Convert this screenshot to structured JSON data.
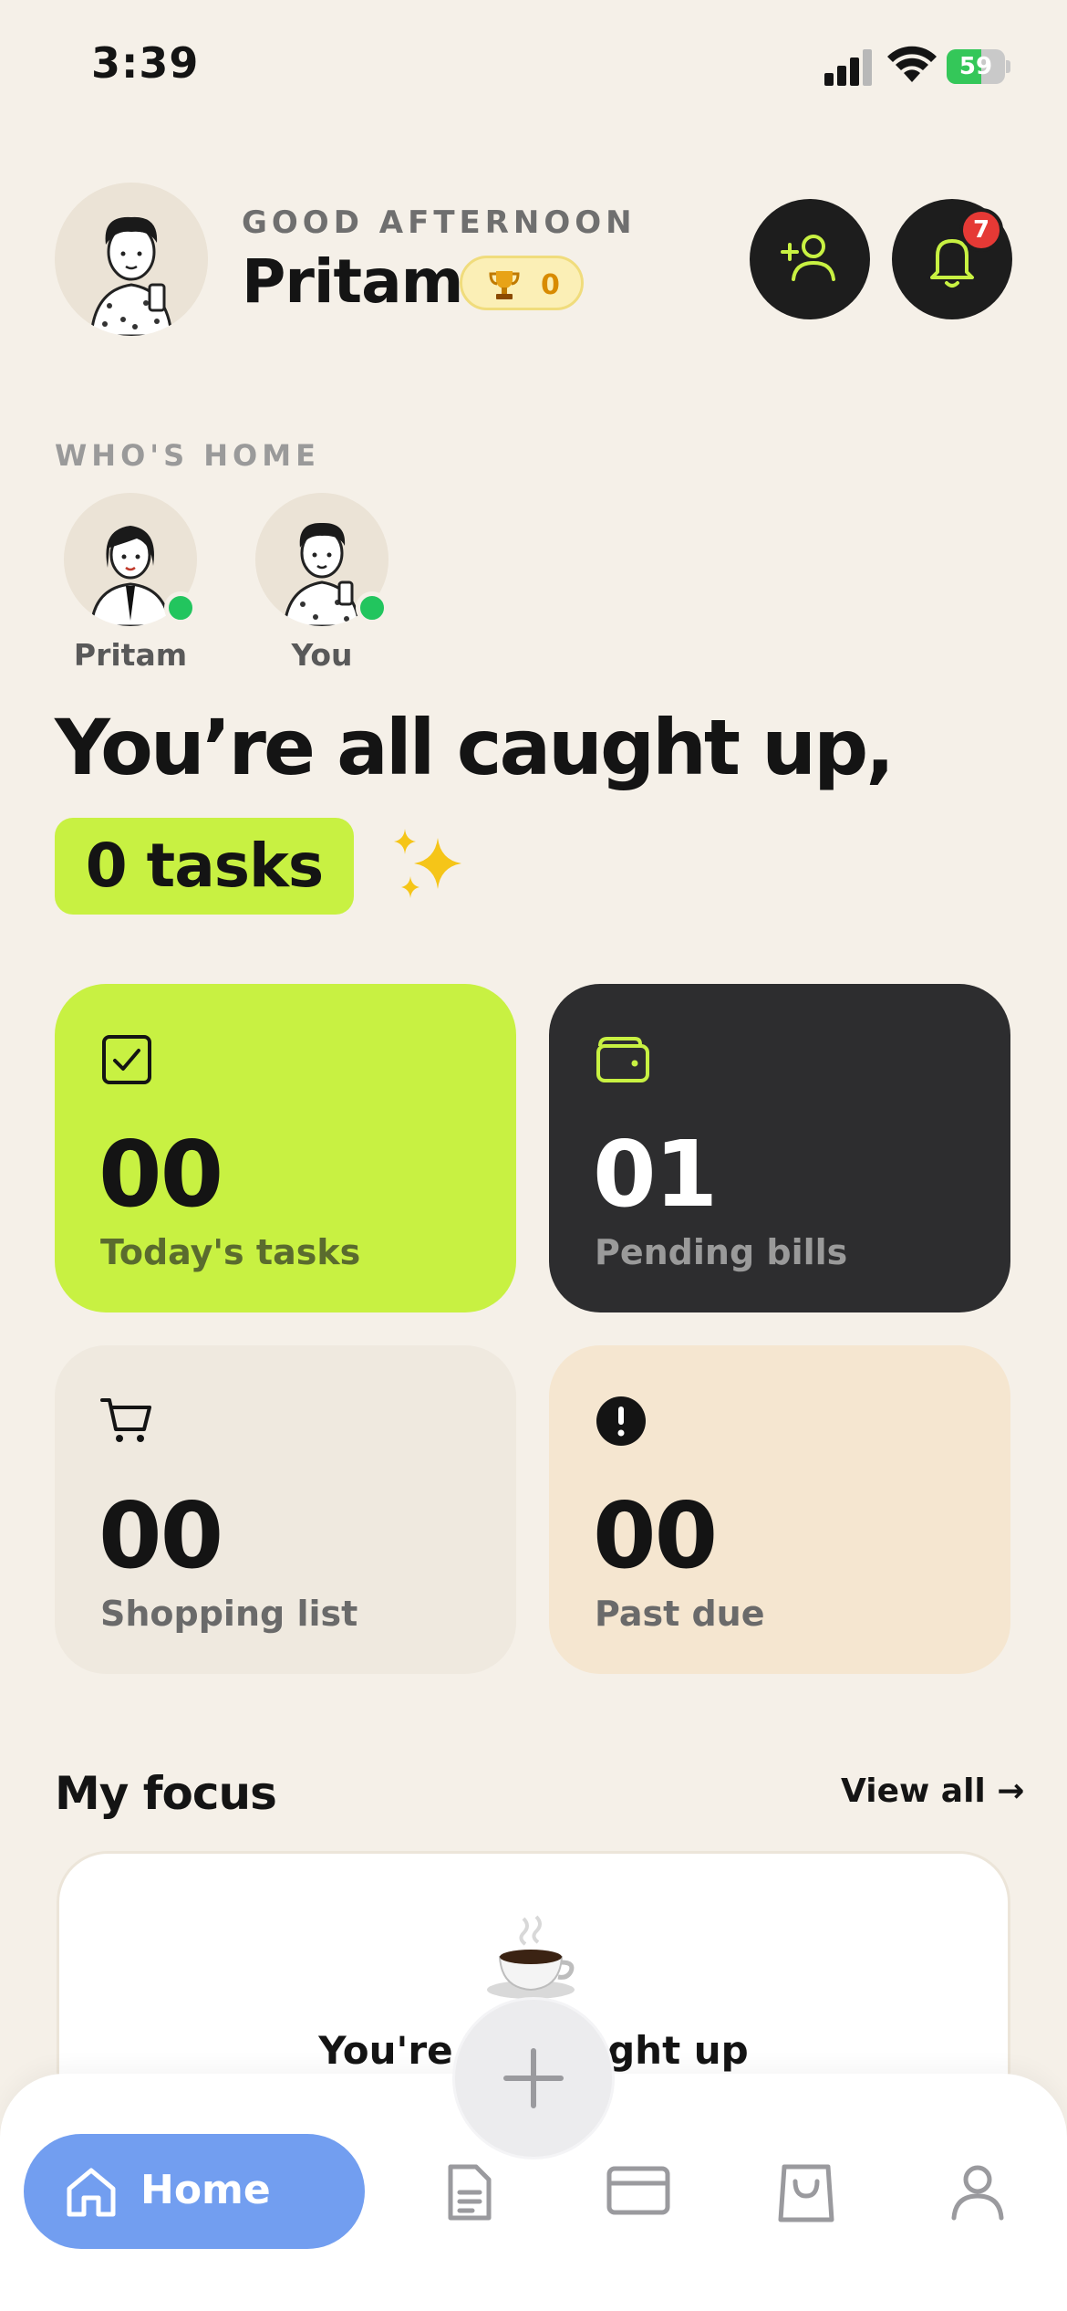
{
  "status_bar": {
    "time": "3:39",
    "battery": "59",
    "battery_level": 0.59
  },
  "header": {
    "greeting": "GOOD AFTERNOON",
    "name": "Pritam",
    "trophy_points": "0",
    "notification_count": "7"
  },
  "whos_home": {
    "label": "WHO'S HOME",
    "members": [
      {
        "name": "Pritam",
        "online": true
      },
      {
        "name": "You",
        "online": true
      }
    ]
  },
  "summary": {
    "heading": "You’re all caught up,",
    "tasks_pill": "0 tasks"
  },
  "cards": [
    {
      "value": "00",
      "label": "Today's tasks",
      "icon": "checkbox-icon"
    },
    {
      "value": "01",
      "label": "Pending bills",
      "icon": "wallet-icon"
    },
    {
      "value": "00",
      "label": "Shopping list",
      "icon": "cart-icon"
    },
    {
      "value": "00",
      "label": "Past due",
      "icon": "alert-icon"
    }
  ],
  "focus": {
    "title": "My focus",
    "view_all": "View all →",
    "empty_text": "You're all caught up"
  },
  "nav": {
    "home_label": "Home",
    "items": [
      "home-icon",
      "document-icon",
      "card-icon",
      "bag-icon",
      "profile-icon"
    ]
  },
  "colors": {
    "background": "#f5f0e8",
    "accent_lime": "#c8f142",
    "dark": "#2d2d2f",
    "nav_active": "#729ef0",
    "online": "#22c55e",
    "badge": "#e53935"
  }
}
